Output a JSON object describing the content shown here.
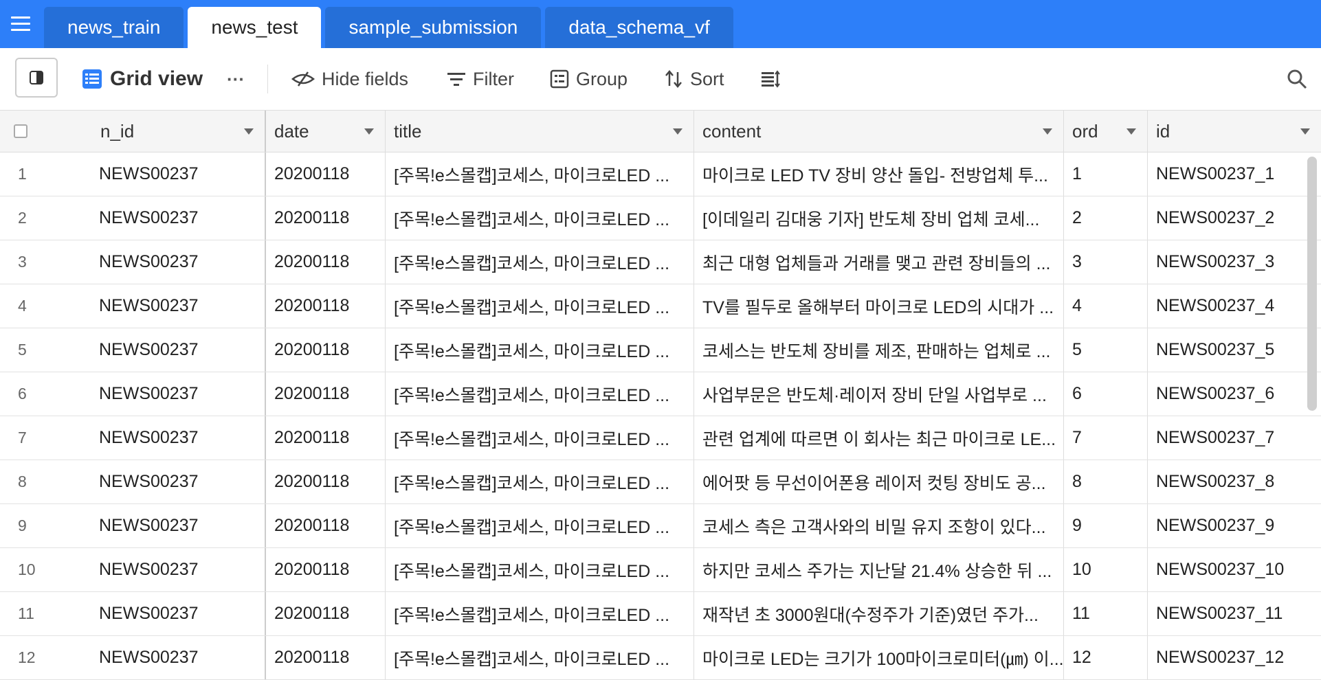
{
  "tabs": [
    {
      "label": "news_train",
      "active": false
    },
    {
      "label": "news_test",
      "active": true
    },
    {
      "label": "sample_submission",
      "active": false
    },
    {
      "label": "data_schema_vf",
      "active": false
    }
  ],
  "toolbar": {
    "view_name": "Grid view",
    "more": "···",
    "hide_fields": "Hide fields",
    "filter": "Filter",
    "group": "Group",
    "sort": "Sort"
  },
  "columns": [
    "n_id",
    "date",
    "title",
    "content",
    "ord",
    "id"
  ],
  "rows": [
    {
      "num": "1",
      "n_id": "NEWS00237",
      "date": "20200118",
      "title": "[주목!e스몰캡]코세스, 마이크로LED ...",
      "content": "마이크로 LED TV 장비 양산 돌입- 전방업체 투...",
      "ord": "1",
      "id": "NEWS00237_1"
    },
    {
      "num": "2",
      "n_id": "NEWS00237",
      "date": "20200118",
      "title": "[주목!e스몰캡]코세스, 마이크로LED ...",
      "content": "[이데일리 김대웅 기자] 반도체 장비 업체 코세...",
      "ord": "2",
      "id": "NEWS00237_2"
    },
    {
      "num": "3",
      "n_id": "NEWS00237",
      "date": "20200118",
      "title": "[주목!e스몰캡]코세스, 마이크로LED ...",
      "content": "최근 대형 업체들과 거래를 맺고 관련 장비들의 ...",
      "ord": "3",
      "id": "NEWS00237_3"
    },
    {
      "num": "4",
      "n_id": "NEWS00237",
      "date": "20200118",
      "title": "[주목!e스몰캡]코세스, 마이크로LED ...",
      "content": "TV를 필두로 올해부터 마이크로 LED의 시대가 ...",
      "ord": "4",
      "id": "NEWS00237_4"
    },
    {
      "num": "5",
      "n_id": "NEWS00237",
      "date": "20200118",
      "title": "[주목!e스몰캡]코세스, 마이크로LED ...",
      "content": "코세스는 반도체 장비를 제조, 판매하는 업체로 ...",
      "ord": "5",
      "id": "NEWS00237_5"
    },
    {
      "num": "6",
      "n_id": "NEWS00237",
      "date": "20200118",
      "title": "[주목!e스몰캡]코세스, 마이크로LED ...",
      "content": "사업부문은 반도체·레이저 장비 단일 사업부로 ...",
      "ord": "6",
      "id": "NEWS00237_6"
    },
    {
      "num": "7",
      "n_id": "NEWS00237",
      "date": "20200118",
      "title": "[주목!e스몰캡]코세스, 마이크로LED ...",
      "content": "관련 업계에 따르면 이 회사는 최근 마이크로 LE...",
      "ord": "7",
      "id": "NEWS00237_7"
    },
    {
      "num": "8",
      "n_id": "NEWS00237",
      "date": "20200118",
      "title": "[주목!e스몰캡]코세스, 마이크로LED ...",
      "content": "에어팟 등 무선이어폰용 레이저 컷팅 장비도 공...",
      "ord": "8",
      "id": "NEWS00237_8"
    },
    {
      "num": "9",
      "n_id": "NEWS00237",
      "date": "20200118",
      "title": "[주목!e스몰캡]코세스, 마이크로LED ...",
      "content": "코세스 측은 고객사와의 비밀 유지 조항이 있다...",
      "ord": "9",
      "id": "NEWS00237_9"
    },
    {
      "num": "10",
      "n_id": "NEWS00237",
      "date": "20200118",
      "title": "[주목!e스몰캡]코세스, 마이크로LED ...",
      "content": "하지만 코세스 주가는 지난달 21.4% 상승한 뒤 ...",
      "ord": "10",
      "id": "NEWS00237_10"
    },
    {
      "num": "11",
      "n_id": "NEWS00237",
      "date": "20200118",
      "title": "[주목!e스몰캡]코세스, 마이크로LED ...",
      "content": "재작년 초 3000원대(수정주가 기준)였던 주가...",
      "ord": "11",
      "id": "NEWS00237_11"
    },
    {
      "num": "12",
      "n_id": "NEWS00237",
      "date": "20200118",
      "title": "[주목!e스몰캡]코세스, 마이크로LED ...",
      "content": "마이크로 LED는 크기가 100마이크로미터(㎛) 이...",
      "ord": "12",
      "id": "NEWS00237_12"
    }
  ],
  "colors": {
    "accent": "#2d7ff9",
    "tab_inactive": "#256fd8"
  }
}
